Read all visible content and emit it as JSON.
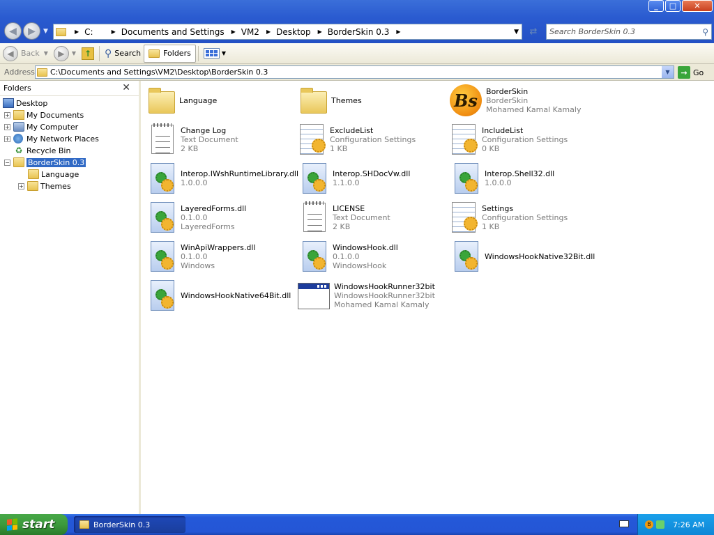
{
  "window": {
    "minimize_glyph": "_",
    "maximize_glyph": "□",
    "close_glyph": "✕"
  },
  "breadcrumb": {
    "items": [
      "C:",
      "Documents and Settings",
      "VM2",
      "Desktop",
      "BorderSkin 0.3"
    ]
  },
  "search": {
    "placeholder": "Search BorderSkin 0.3"
  },
  "toolbar": {
    "back_label": "Back",
    "search_label": "Search",
    "folders_label": "Folders"
  },
  "address": {
    "label": "Address",
    "value": "C:\\Documents and Settings\\VM2\\Desktop\\BorderSkin 0.3",
    "go_label": "Go"
  },
  "folders_pane": {
    "title": "Folders",
    "close_glyph": "✕",
    "tree": [
      {
        "label": "Desktop",
        "icon": "desktop-icon",
        "expander": "",
        "level": 0
      },
      {
        "label": "My Documents",
        "icon": "my-documents-icon",
        "expander": "+",
        "level": 1
      },
      {
        "label": "My Computer",
        "icon": "computer-icon",
        "expander": "+",
        "level": 1
      },
      {
        "label": "My Network Places",
        "icon": "network-icon",
        "expander": "+",
        "level": 1
      },
      {
        "label": "Recycle Bin",
        "icon": "recycle-bin-icon",
        "expander": "",
        "level": 1
      },
      {
        "label": "BorderSkin 0.3",
        "icon": "folder-icon",
        "expander": "−",
        "level": 1,
        "selected": true
      },
      {
        "label": "Language",
        "icon": "folder-icon",
        "expander": "",
        "level": 2
      },
      {
        "label": "Themes",
        "icon": "folder-icon",
        "expander": "+",
        "level": 2
      }
    ]
  },
  "files": [
    {
      "name": "Language",
      "line2": "",
      "line3": "",
      "icon": "folder-icon"
    },
    {
      "name": "Themes",
      "line2": "",
      "line3": "",
      "icon": "folder-icon"
    },
    {
      "name": "BorderSkin",
      "line2": "BorderSkin",
      "line3": "Mohamed Kamal Kamaly",
      "icon": "borderskin-logo-icon",
      "logo_letters": "Bs"
    },
    {
      "name": "Change Log",
      "line2": "Text Document",
      "line3": "2 KB",
      "icon": "text-document-icon"
    },
    {
      "name": "ExcludeList",
      "line2": "Configuration Settings",
      "line3": "1 KB",
      "icon": "config-settings-icon"
    },
    {
      "name": "IncludeList",
      "line2": "Configuration Settings",
      "line3": "0 KB",
      "icon": "config-settings-icon"
    },
    {
      "name": "Interop.IWshRuntimeLibrary.dll",
      "line2": "1.0.0.0",
      "line3": "",
      "icon": "dll-icon"
    },
    {
      "name": "Interop.SHDocVw.dll",
      "line2": "1.1.0.0",
      "line3": "",
      "icon": "dll-icon"
    },
    {
      "name": "Interop.Shell32.dll",
      "line2": "1.0.0.0",
      "line3": "",
      "icon": "dll-icon"
    },
    {
      "name": "LayeredForms.dll",
      "line2": "0.1.0.0",
      "line3": "LayeredForms",
      "icon": "dll-icon"
    },
    {
      "name": "LICENSE",
      "line2": "Text Document",
      "line3": "2 KB",
      "icon": "text-document-icon"
    },
    {
      "name": "Settings",
      "line2": "Configuration Settings",
      "line3": "1 KB",
      "icon": "config-settings-icon"
    },
    {
      "name": "WinApiWrappers.dll",
      "line2": "0.1.0.0",
      "line3": "Windows",
      "icon": "dll-icon"
    },
    {
      "name": "WindowsHook.dll",
      "line2": "0.1.0.0",
      "line3": "WindowsHook",
      "icon": "dll-icon"
    },
    {
      "name": "WindowsHookNative32Bit.dll",
      "line2": "",
      "line3": "",
      "icon": "dll-icon"
    },
    {
      "name": "WindowsHookNative64Bit.dll",
      "line2": "",
      "line3": "",
      "icon": "dll-icon"
    },
    {
      "name": "WindowsHookRunner32bit",
      "line2": "WindowsHookRunner32bit",
      "line3": "Mohamed Kamal Kamaly",
      "icon": "application-icon"
    }
  ],
  "taskbar": {
    "start_label": "start",
    "window_item": "BorderSkin 0.3",
    "tray_logo_letter": "B",
    "clock": "7:26 AM"
  },
  "colors": {
    "titlebar": "#2350c4",
    "selection": "#316ac5",
    "taskbar": "#2456d6",
    "start_button": "#3c9a3c",
    "tray": "#0f86d6"
  }
}
